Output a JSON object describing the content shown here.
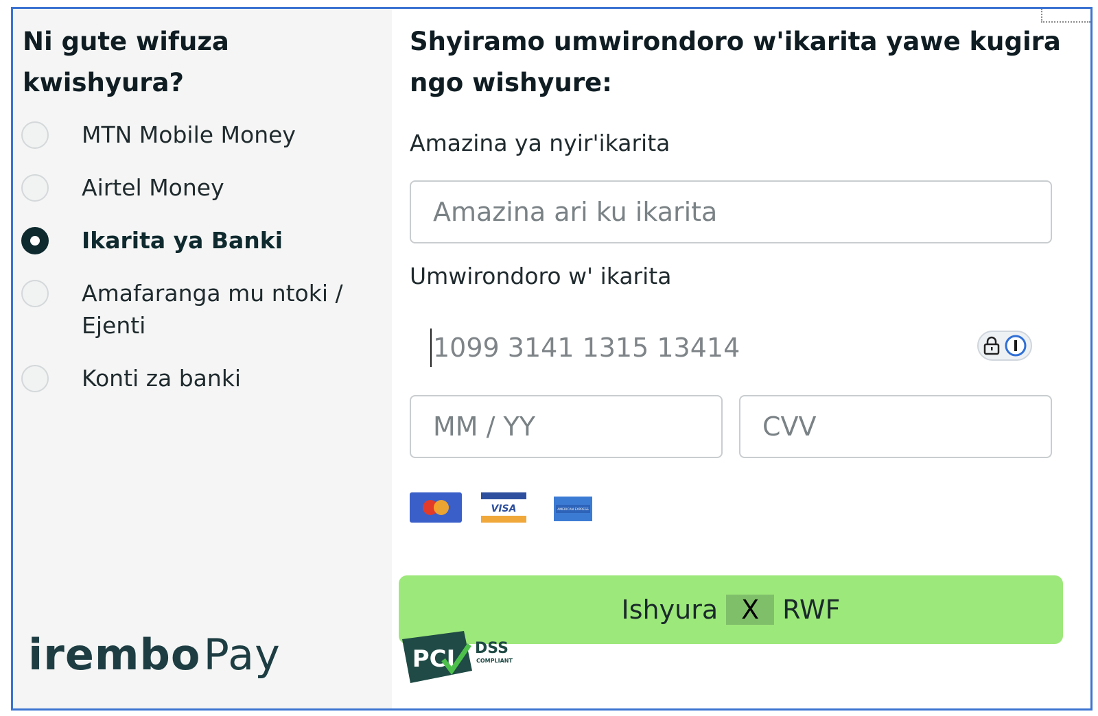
{
  "left": {
    "title": "Ni gute wifuza kwishyura?",
    "methods": [
      {
        "label": "MTN Mobile Money",
        "selected": false
      },
      {
        "label": "Airtel Money",
        "selected": false
      },
      {
        "label": "Ikarita ya Banki",
        "selected": true
      },
      {
        "label": "Amafaranga mu ntoki / Ejenti",
        "selected": false
      },
      {
        "label": "Konti za banki",
        "selected": false
      }
    ],
    "brand": {
      "part1": "irembo",
      "part2": "Pay"
    }
  },
  "form": {
    "title": "Shyiramo umwirondoro w'ikarita yawe kugira ngo wishyure:",
    "name_label": "Amazina ya nyir'ikarita",
    "name_placeholder": "Amazina ari ku ikarita",
    "number_label": "Umwirondoro w' ikarita",
    "number_placeholder": "1099 3141 1315 13414",
    "expiry_placeholder": "MM / YY",
    "cvv_placeholder": "CVV",
    "card_brands": [
      "mastercard-icon",
      "visa-icon",
      "amex-icon"
    ],
    "visa_text": "VISA",
    "amex_text": "AMERICAN EXPRESS"
  },
  "pay_button": {
    "prefix": "Ishyura",
    "amount": "X",
    "currency": "RWF"
  },
  "pci": {
    "main": "PCI",
    "dss": "DSS",
    "compliant": "COMPLIANT"
  },
  "colors": {
    "accent_button": "#9de87a",
    "frame_border": "#3b73d1",
    "selected_radio": "#0f2a2f"
  }
}
